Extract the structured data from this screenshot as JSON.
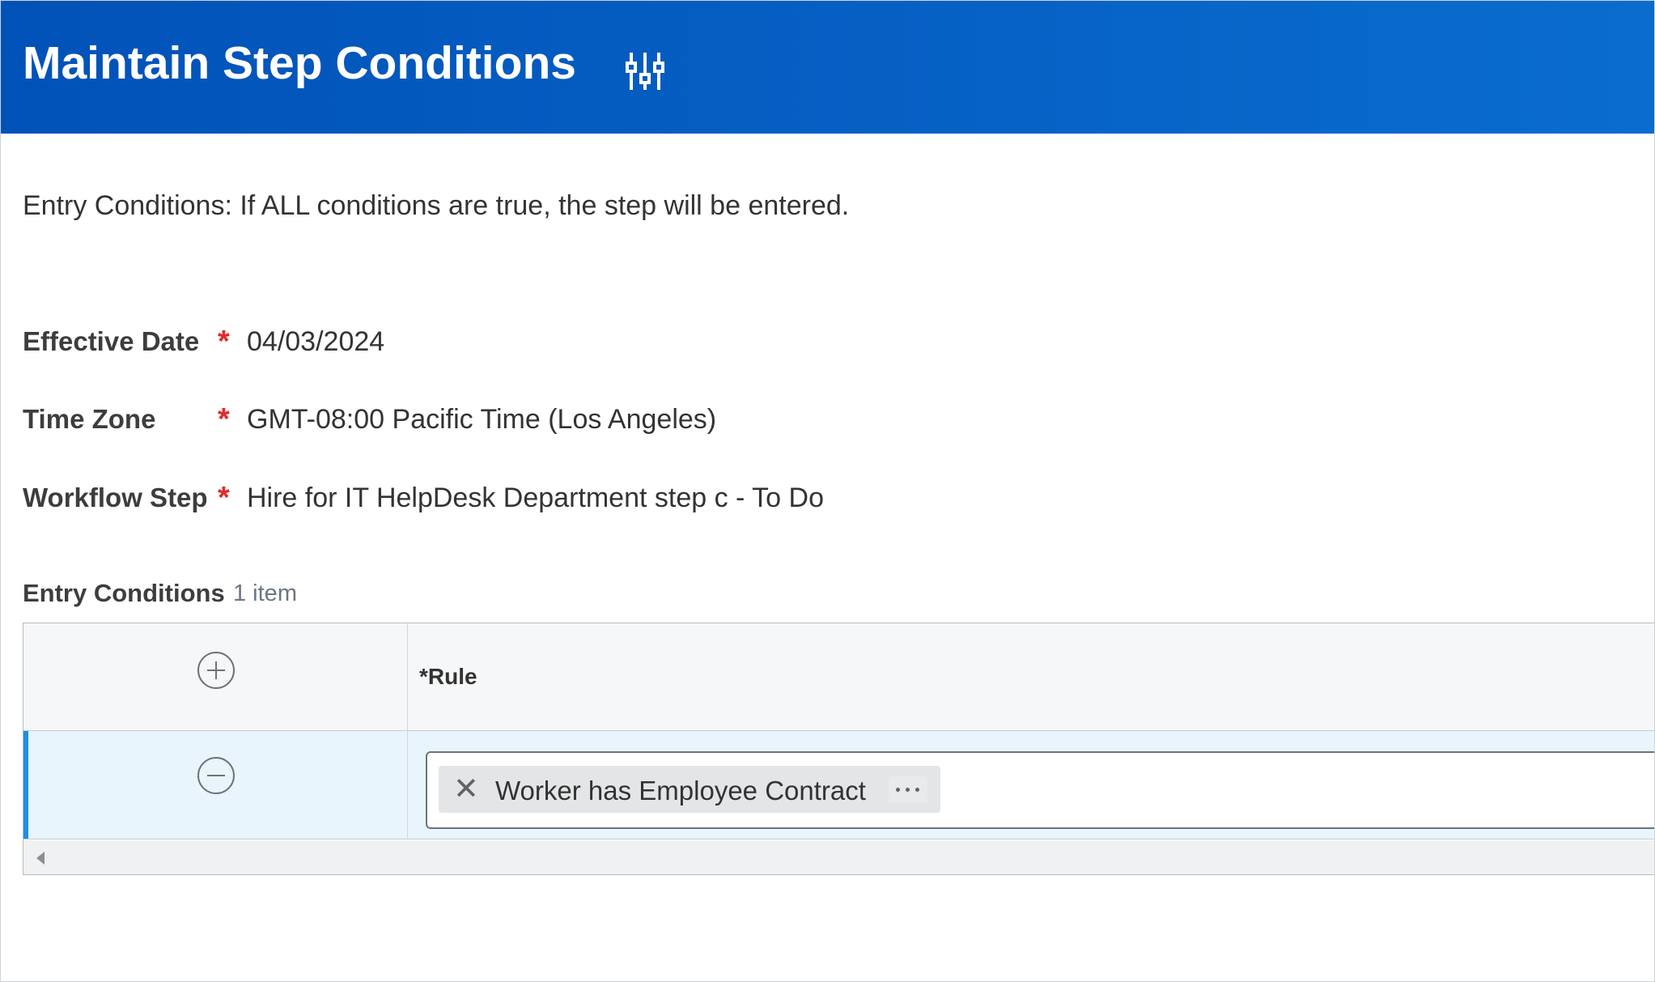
{
  "header": {
    "title": "Maintain Step Conditions",
    "filter_icon": "related-actions-sliders-icon",
    "background": "#0159c2"
  },
  "intro": "Entry Conditions: If ALL conditions are true, the step will be entered.",
  "fields": [
    {
      "label": "Effective Date",
      "required": "*",
      "value": "04/03/2024"
    },
    {
      "label": "Time Zone",
      "required": "*",
      "value": "GMT-08:00 Pacific Time (Los Angeles)"
    },
    {
      "label": "Workflow Step",
      "required": "*",
      "value": "Hire for IT HelpDesk Department step c - To Do"
    }
  ],
  "entry_conditions": {
    "title": "Entry Conditions",
    "count": "1 item",
    "columns": [
      "*Rule"
    ],
    "rows": [
      {
        "rule": "Worker has Employee Contract",
        "remove_icon": "x-icon",
        "more_icon": "ellipsis-icon"
      }
    ]
  },
  "colors": {
    "required": "#de2c2c",
    "selected_row": "#e8f5fc",
    "row_accent": "#1e8ee8"
  }
}
